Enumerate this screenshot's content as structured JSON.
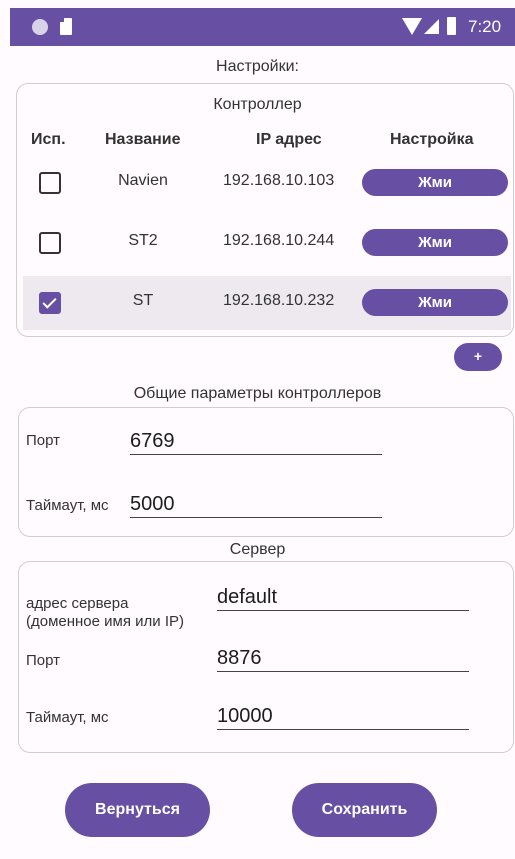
{
  "status_bar": {
    "time": "7:20"
  },
  "page_title": "Настройки:",
  "controller": {
    "section_title": "Контроллер",
    "headers": {
      "use": "Исп.",
      "name": "Название",
      "ip": "IP адрес",
      "settings": "Настройка"
    },
    "rows": [
      {
        "checked": false,
        "name": "Navien",
        "ip": "192.168.10.103",
        "button": "Жми"
      },
      {
        "checked": false,
        "name": "ST2",
        "ip": "192.168.10.244",
        "button": "Жми"
      },
      {
        "checked": true,
        "name": "ST",
        "ip": "192.168.10.232",
        "button": "Жми"
      }
    ],
    "add_button": "+"
  },
  "common": {
    "section_title": "Общие параметры контроллеров",
    "port_label": "Порт",
    "port_value": "6769",
    "timeout_label": "Таймаут, мс",
    "timeout_value": "5000"
  },
  "server": {
    "section_title": "Сервер",
    "address_label_1": "адрес сервера",
    "address_label_2": "(доменное имя или IP)",
    "address_value": "default",
    "port_label": "Порт",
    "port_value": "8876",
    "timeout_label": "Таймаут, мс",
    "timeout_value": "10000"
  },
  "buttons": {
    "back": "Вернуться",
    "save": "Сохранить"
  },
  "colors": {
    "accent": "#6750a4",
    "selected_row": "#ede9ef"
  }
}
